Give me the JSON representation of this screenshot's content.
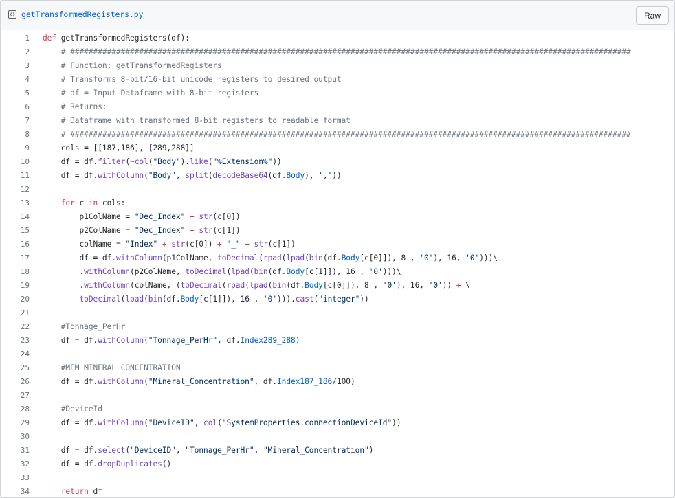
{
  "file": {
    "name": "getTransformedRegisters.py",
    "raw_label": "Raw",
    "icon": "code-file-icon"
  },
  "lines": [
    {
      "n": "1",
      "t": "def getTransformedRegisters(df):"
    },
    {
      "n": "2",
      "t": "    # ##########################################################################################################################"
    },
    {
      "n": "3",
      "t": "    # Function: getTransformedRegisters"
    },
    {
      "n": "4",
      "t": "    # Transforms 8-bit/16-bit unicode registers to desired output"
    },
    {
      "n": "5",
      "t": "    # df = Input Dataframe with 8-bit registers"
    },
    {
      "n": "6",
      "t": "    # Returns:"
    },
    {
      "n": "7",
      "t": "    # Dataframe with transformed 8-bit registers to readable format"
    },
    {
      "n": "8",
      "t": "    # ##########################################################################################################################"
    },
    {
      "n": "9",
      "t": "    cols = [[187,186], [289,288]]"
    },
    {
      "n": "10",
      "t": "    df = df.filter(~col(\"Body\").like(\"%Extension%\"))"
    },
    {
      "n": "11",
      "t": "    df = df.withColumn(\"Body\", split(decodeBase64(df.Body), ','))"
    },
    {
      "n": "12",
      "t": ""
    },
    {
      "n": "13",
      "t": "    for c in cols:"
    },
    {
      "n": "14",
      "t": "        p1ColName = \"Dec_Index\" + str(c[0])"
    },
    {
      "n": "15",
      "t": "        p2ColName = \"Dec_Index\" + str(c[1])"
    },
    {
      "n": "16",
      "t": "        colName = \"Index\" + str(c[0]) + \"_\" + str(c[1])"
    },
    {
      "n": "17",
      "t": "        df = df.withColumn(p1ColName, toDecimal(rpad(lpad(bin(df.Body[c[0]]), 8 , '0'), 16, '0')))\\"
    },
    {
      "n": "18",
      "t": "        .withColumn(p2ColName, toDecimal(lpad(bin(df.Body[c[1]]), 16 , '0')))\\"
    },
    {
      "n": "19",
      "t": "        .withColumn(colName, (toDecimal(rpad(lpad(bin(df.Body[c[0]]), 8 , '0'), 16, '0')) + \\"
    },
    {
      "n": "20",
      "t": "        toDecimal(lpad(bin(df.Body[c[1]]), 16 , '0'))).cast(\"integer\"))"
    },
    {
      "n": "21",
      "t": ""
    },
    {
      "n": "22",
      "t": "    #Tonnage_PerHr"
    },
    {
      "n": "23",
      "t": "    df = df.withColumn(\"Tonnage_PerHr\", df.Index289_288)"
    },
    {
      "n": "24",
      "t": ""
    },
    {
      "n": "25",
      "t": "    #MEM_MINERAL_CONCENTRATION"
    },
    {
      "n": "26",
      "t": "    df = df.withColumn(\"Mineral_Concentration\", df.Index187_186/100)"
    },
    {
      "n": "27",
      "t": ""
    },
    {
      "n": "28",
      "t": "    #DeviceId"
    },
    {
      "n": "29",
      "t": "    df = df.withColumn(\"DeviceID\", col(\"SystemProperties.connectionDeviceId\"))"
    },
    {
      "n": "30",
      "t": ""
    },
    {
      "n": "31",
      "t": "    df = df.select(\"DeviceID\", \"Tonnage_PerHr\", \"Mineral_Concentration\")"
    },
    {
      "n": "32",
      "t": "    df = df.dropDuplicates()"
    },
    {
      "n": "33",
      "t": ""
    },
    {
      "n": "34",
      "t": "    return df"
    }
  ],
  "colors": {
    "keyword": "#d73a49",
    "function": "#6f42c1",
    "string": "#032f62",
    "comment": "#6a737d",
    "link": "#0366d6"
  }
}
